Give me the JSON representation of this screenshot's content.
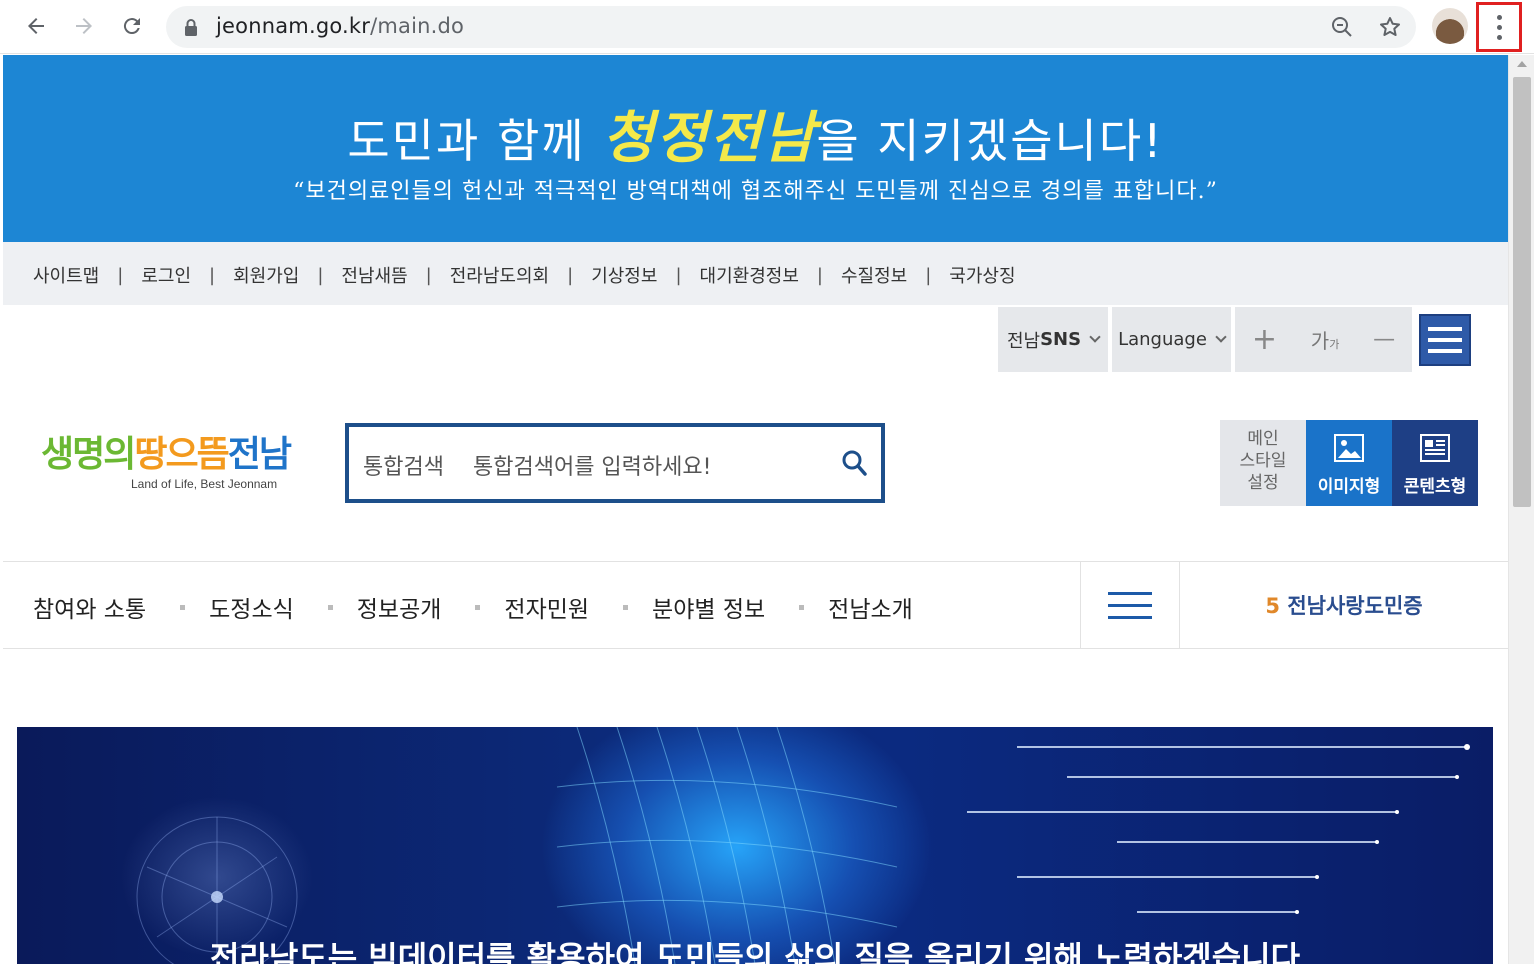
{
  "browser": {
    "url_host": "jeonnam.go.kr",
    "url_path": "/main.do",
    "icons": [
      "back-arrow-icon",
      "forward-arrow-icon",
      "reload-icon",
      "lock-icon",
      "zoom-icon",
      "star-icon",
      "profile-avatar",
      "kebab-menu-icon"
    ]
  },
  "banner": {
    "headline_before": "도민과 함께 ",
    "headline_highlight": "청정전남",
    "headline_after": "을 지키겠습니다!",
    "quote": "“보건의료인들의 헌신과 적극적인 방역대책에 협조해주신 도민들께 진심으로 경의를 표합니다.”",
    "colors": {
      "background": "#1d86d4",
      "highlight": "#f4e94a"
    }
  },
  "util_links": [
    "사이트맵",
    "로그인",
    "회원가입",
    "전남새뜸",
    "전라남도의회",
    "기상정보",
    "대기환경정보",
    "수질정보",
    "국가상징"
  ],
  "tools": {
    "sns_prefix": "전남 ",
    "sns_bold": "SNS",
    "language": "Language",
    "font_plus": "+",
    "font_ga": "가",
    "font_ga_small": "가",
    "font_minus": "—"
  },
  "logo": {
    "part1": "생명의",
    "part2": "땅",
    "part3": "으뜸",
    "part4": "전남",
    "tagline": "Land of Life, Best Jeonnam"
  },
  "search": {
    "label": "통합검색",
    "placeholder": "통합검색어를 입력하세요!"
  },
  "style_settings": {
    "title_line1": "메인",
    "title_line2": "스타일",
    "title_line3": "설정",
    "image_type": "이미지형",
    "content_type": "콘텐츠형"
  },
  "nav": {
    "items": [
      "참여와 소통",
      "도정소식",
      "정보공개",
      "전자민원",
      "분야별 정보",
      "전남소개"
    ],
    "love_num": "5",
    "love_label": " 전남사랑도민증"
  },
  "hero": {
    "caption": "전라남도는 빅데이터를 활용하여 도민들의 삶의 질을 올리기 위해 노력하겠습니다"
  }
}
